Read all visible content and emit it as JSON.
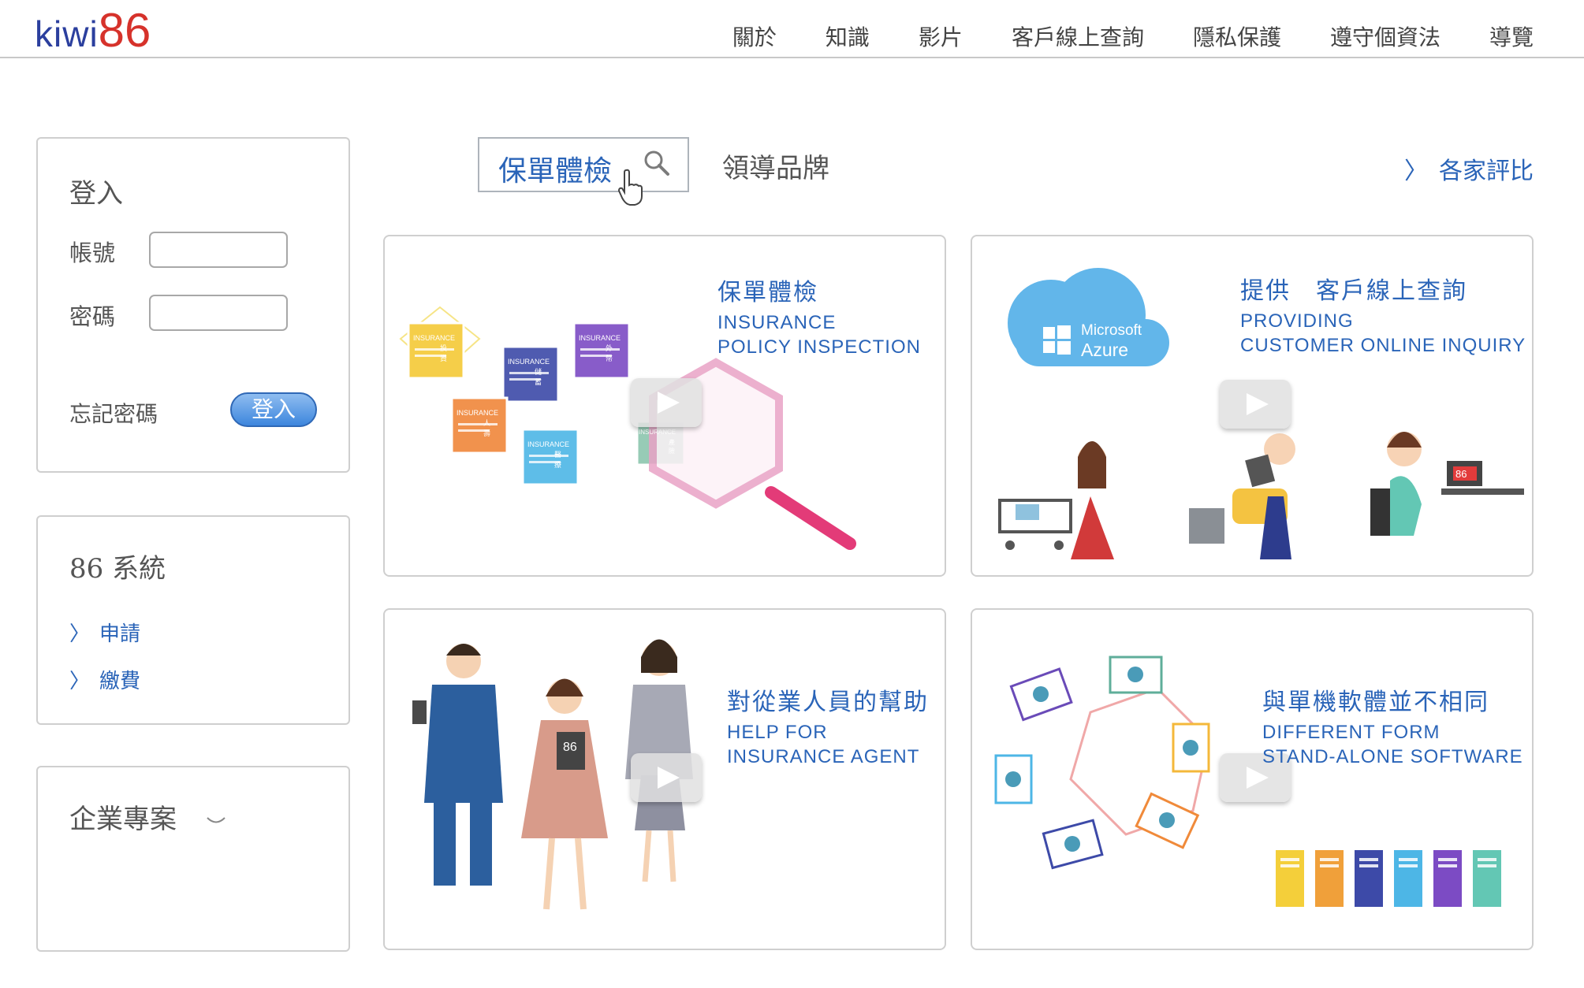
{
  "header": {
    "logo_text": "kiwi",
    "logo_number": "86",
    "nav": [
      "關於",
      "知識",
      "影片",
      "客戶線上查詢",
      "隱私保護",
      "遵守個資法",
      "導覽"
    ]
  },
  "login": {
    "title": "登入",
    "account_label": "帳號",
    "password_label": "密碼",
    "account_value": "",
    "password_value": "",
    "forgot_label": "忘記密碼",
    "submit_label": "登入"
  },
  "system": {
    "title": "86 系統",
    "links": [
      "申請",
      "繳費"
    ]
  },
  "enterprise": {
    "title": "企業專案"
  },
  "tabs": {
    "active_label": "保單體檢",
    "brand_label": "領導品牌",
    "compare_link": "各家評比"
  },
  "cards": [
    {
      "title": "保單體檢",
      "sub1": "INSURANCE",
      "sub2": "POLICY INSPECTION"
    },
    {
      "title": "提供　客戶線上查詢",
      "sub1": "PROVIDING",
      "sub2": "CUSTOMER ONLINE INQUIRY"
    },
    {
      "title": "對從業人員的幫助",
      "sub1": "HELP FOR",
      "sub2": "INSURANCE AGENT"
    },
    {
      "title": "與單機軟體並不相同",
      "sub1": "DIFFERENT FORM",
      "sub2": "STAND-ALONE SOFTWARE"
    }
  ],
  "art": {
    "doc_word": "INSURANCE",
    "doc_labels": [
      "投資",
      "儲蓄",
      "外幣",
      "人壽",
      "醫療",
      "產險"
    ],
    "cloud_brand": "Microsoft",
    "cloud_product": "Azure",
    "badge": "86"
  },
  "colors": {
    "accent_blue": "#2a64b8",
    "logo_blue": "#2b3f9e",
    "logo_red": "#d6322b",
    "border": "#cfcfcf"
  }
}
